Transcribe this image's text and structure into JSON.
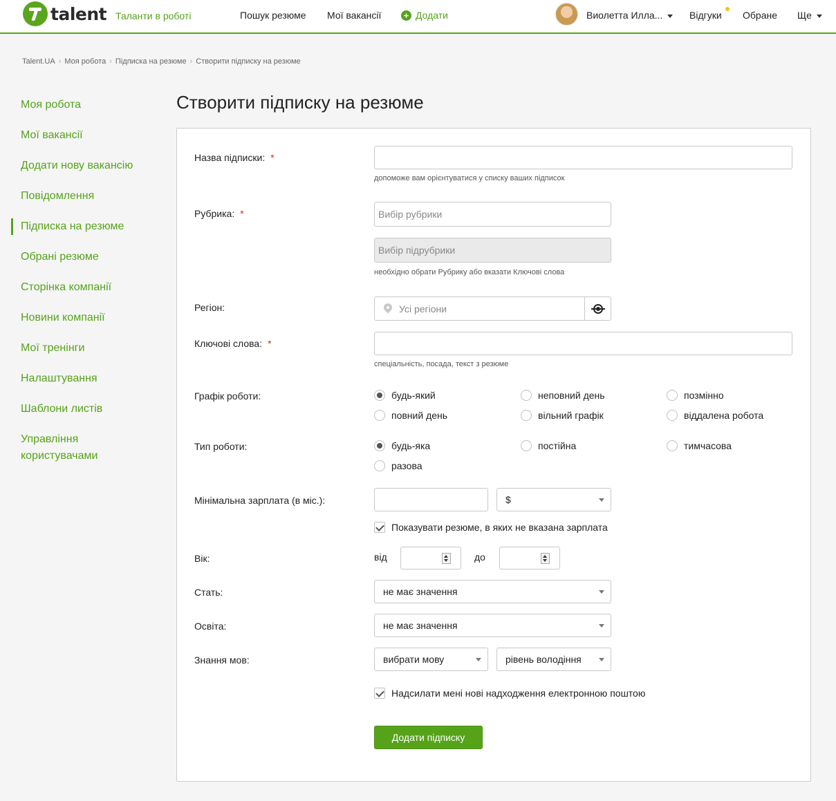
{
  "header": {
    "logo_text": "talent",
    "tagline": "Таланти в роботі",
    "nav_search": "Пошук резюме",
    "nav_vacancies": "Мої вакансії",
    "nav_add": "Додати",
    "user_name": "Виолетта Илла...",
    "nav_responses": "Відгуки",
    "nav_favorites": "Обране",
    "nav_more": "Ще"
  },
  "breadcrumb": [
    "Talent.UA",
    "Моя робота",
    "Підписка на резюме",
    "Створити підписку на резюме"
  ],
  "sidebar": {
    "items": [
      {
        "label": "Моя робота"
      },
      {
        "label": "Мої вакансії"
      },
      {
        "label": "Додати нову вакансію"
      },
      {
        "label": "Повідомлення"
      },
      {
        "label": "Підписка на резюме"
      },
      {
        "label": "Обрані резюме"
      },
      {
        "label": "Сторінка компанії"
      },
      {
        "label": "Новини компанії"
      },
      {
        "label": "Мої тренінги"
      },
      {
        "label": "Налаштування"
      },
      {
        "label": "Шаблони листів"
      },
      {
        "label": "Управління користувачами"
      }
    ],
    "active_index": 4
  },
  "page_title": "Створити підписку на резюме",
  "form": {
    "name_label": "Назва підписки:",
    "name_value": "",
    "name_hint": "допоможе вам орієнтуватися у списку ваших підписок",
    "rubric_label": "Рубрика:",
    "rubric_placeholder": "Вибір рубрики",
    "subrubric_placeholder": "Вибір підрубрики",
    "rubric_hint": "необхідно обрати Рубрику або вказати Ключові слова",
    "region_label": "Регіон:",
    "region_placeholder": "Усі регіони",
    "keywords_label": "Ключові слова:",
    "keywords_value": "",
    "keywords_hint": "спеціальність, посада, текст з резюме",
    "required_mark": "*",
    "schedule_label": "Графік роботи:",
    "schedule_options": [
      {
        "label": "будь-який",
        "checked": true
      },
      {
        "label": "неповний день",
        "checked": false
      },
      {
        "label": "позмінно",
        "checked": false
      },
      {
        "label": "повний день",
        "checked": false
      },
      {
        "label": "вільний графік",
        "checked": false
      },
      {
        "label": "віддалена робота",
        "checked": false
      }
    ],
    "worktype_label": "Тип роботи:",
    "worktype_options": [
      {
        "label": "будь-яка",
        "checked": true
      },
      {
        "label": "постійна",
        "checked": false
      },
      {
        "label": "тимчасова",
        "checked": false
      },
      {
        "label": "разова",
        "checked": false
      }
    ],
    "salary_label": "Мінімальна зарплата (в міс.):",
    "salary_value": "",
    "currency_value": "$",
    "show_no_salary_label": "Показувати резюме, в яких не вказана зарплата",
    "show_no_salary_checked": true,
    "age_label": "Вік:",
    "age_from_label": "від",
    "age_to_label": "до",
    "gender_label": "Стать:",
    "gender_value": "не має значення",
    "education_label": "Освіта:",
    "education_value": "не має значення",
    "languages_label": "Знання мов:",
    "language_value": "вибрати мову",
    "level_value": "рівень володіння",
    "email_label": "Надсилати мені нові надходження електронною поштою",
    "email_checked": true,
    "submit_label": "Додати підписку"
  },
  "colors": {
    "brand_green": "#56a31a",
    "required_red": "#d12d1c",
    "notify_yellow": "#f5c400"
  }
}
